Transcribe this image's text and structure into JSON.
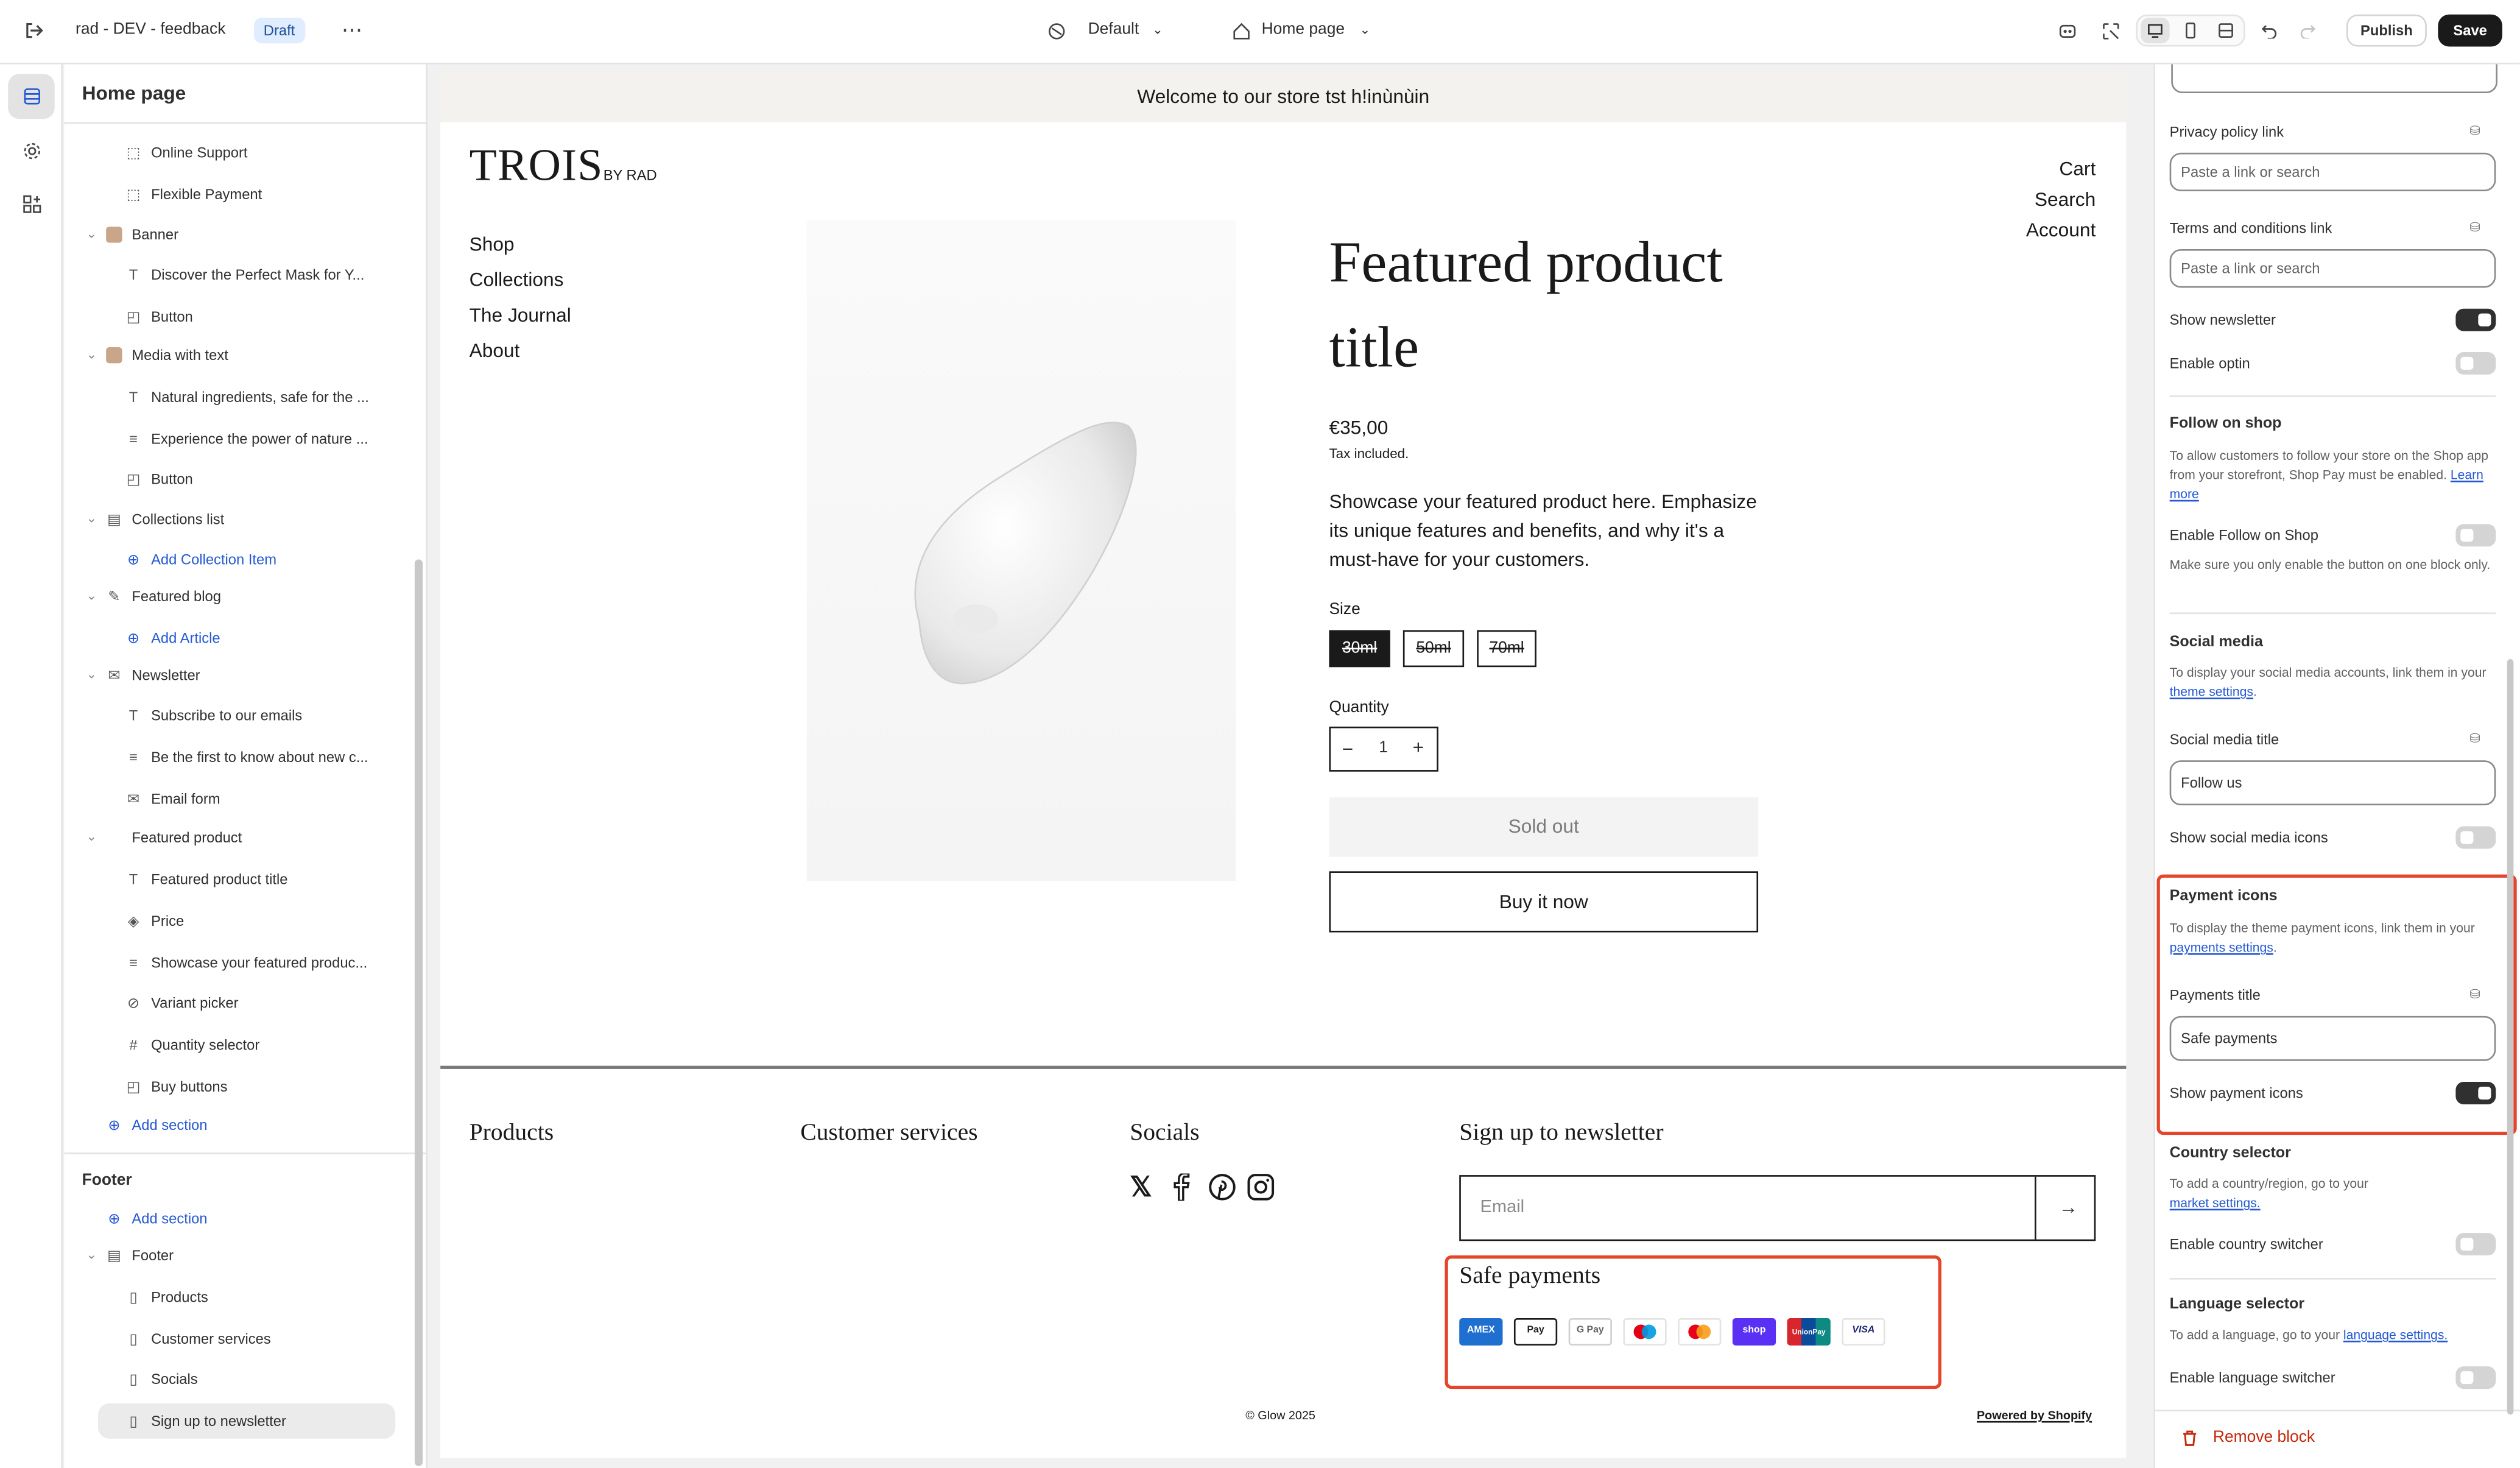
{
  "topbar": {
    "store_name": "rad - DEV - feedback",
    "status_badge": "Draft",
    "theme_select": "Default",
    "page_select": "Home page",
    "publish_label": "Publish",
    "save_label": "Save"
  },
  "sidebar": {
    "title": "Home page",
    "rows": [
      {
        "label": "Online Support",
        "icon": "block-icon"
      },
      {
        "label": "Flexible Payment",
        "icon": "block-icon"
      },
      {
        "label": "Banner",
        "icon": "image-thumb-icon"
      },
      {
        "label": "Discover the Perfect Mask for Y...",
        "icon": "text-icon"
      },
      {
        "label": "Button",
        "icon": "button-icon"
      },
      {
        "label": "Media with text",
        "icon": "image-thumb-icon"
      },
      {
        "label": "Natural ingredients, safe for the ...",
        "icon": "text-icon"
      },
      {
        "label": "Experience the power of nature ...",
        "icon": "paragraph-icon"
      },
      {
        "label": "Button",
        "icon": "button-icon"
      },
      {
        "label": "Collections list",
        "icon": "collection-icon"
      },
      {
        "label": "Add Collection Item",
        "icon": "add-icon"
      },
      {
        "label": "Featured blog",
        "icon": "blog-icon"
      },
      {
        "label": "Add Article",
        "icon": "add-icon"
      },
      {
        "label": "Newsletter",
        "icon": "email-icon"
      },
      {
        "label": "Subscribe to our emails",
        "icon": "text-icon"
      },
      {
        "label": "Be the first to know about new c...",
        "icon": "paragraph-icon"
      },
      {
        "label": "Email form",
        "icon": "email-icon"
      },
      {
        "label": "Featured product",
        "icon": "product-icon"
      },
      {
        "label": "Featured product title",
        "icon": "text-icon"
      },
      {
        "label": "Price",
        "icon": "price-icon"
      },
      {
        "label": "Showcase your featured produc...",
        "icon": "paragraph-icon"
      },
      {
        "label": "Variant picker",
        "icon": "variant-icon"
      },
      {
        "label": "Quantity selector",
        "icon": "hash-icon"
      },
      {
        "label": "Buy buttons",
        "icon": "button-icon"
      },
      {
        "label": "Add section",
        "icon": "add-icon"
      }
    ],
    "footer_group_title": "Footer",
    "footer_rows": [
      {
        "label": "Add section"
      },
      {
        "label": "Footer"
      },
      {
        "label": "Products"
      },
      {
        "label": "Customer services"
      },
      {
        "label": "Socials"
      },
      {
        "label": "Sign up to newsletter"
      }
    ]
  },
  "preview": {
    "announcement": "Welcome to our store tst h!inùnùin",
    "logo_main": "TROIS",
    "logo_sub": "BY RAD",
    "nav": [
      "Shop",
      "Collections",
      "The Journal",
      "About"
    ],
    "utility_nav": [
      "Cart",
      "Search",
      "Account"
    ],
    "product": {
      "title": "Featured product title",
      "price": "€35,00",
      "tax_note": "Tax included.",
      "description": "Showcase your featured product here. Emphasize its unique features and benefits, and why it's a must-have for your customers.",
      "size_label": "Size",
      "sizes": [
        "30ml",
        "50ml",
        "70ml"
      ],
      "quantity_label": "Quantity",
      "quantity_value": "1",
      "sold_out_label": "Sold out",
      "buy_now_label": "Buy it now"
    },
    "footer": {
      "headings": [
        "Products",
        "Customer services",
        "Socials",
        "Sign up to newsletter"
      ],
      "email_placeholder": "Email",
      "payments_title": "Safe payments",
      "payment_icons": [
        "AMEX",
        "Pay",
        "G Pay",
        "Maestro",
        "Mastercard",
        "shop",
        "UnionPay",
        "VISA"
      ],
      "copyright": "© Glow 2025",
      "powered_by": "Powered by Shopify"
    }
  },
  "settings": {
    "privacy_label": "Privacy policy link",
    "privacy_placeholder": "Paste a link or search",
    "terms_label": "Terms and conditions link",
    "terms_placeholder": "Paste a link or search",
    "show_newsletter": "Show newsletter",
    "enable_optin": "Enable optin",
    "follow_title": "Follow on shop",
    "follow_help": "To allow customers to follow your store on the Shop app from your storefront, Shop Pay must be enabled.",
    "follow_help_link": "Learn more",
    "enable_follow": "Enable Follow on Shop",
    "follow_note": "Make sure you only enable the button on one block only.",
    "social_title": "Social media",
    "social_help": "To display your social media accounts, link them in your",
    "social_help_link": "theme settings",
    "social_media_title_label": "Social media title",
    "social_media_title_value": "Follow us",
    "show_social_icons": "Show social media icons",
    "payment_title": "Payment icons",
    "payment_help": "To display the theme payment icons, link them in your",
    "payment_help_link": "payments settings",
    "payments_title_label": "Payments title",
    "payments_title_value": "Safe payments",
    "show_payment_icons": "Show payment icons",
    "country_title": "Country selector",
    "country_help": "To add a country/region, go to your",
    "country_help_link": "market settings.",
    "enable_country": "Enable country switcher",
    "language_title": "Language selector",
    "language_help": "To add a language, go to your",
    "language_help_link": "language settings.",
    "enable_language": "Enable language switcher",
    "remove_block": "Remove block"
  },
  "colors": {
    "highlight": "#e5452b",
    "accent_link": "#2458d4",
    "dark": "#1a1a1a"
  }
}
